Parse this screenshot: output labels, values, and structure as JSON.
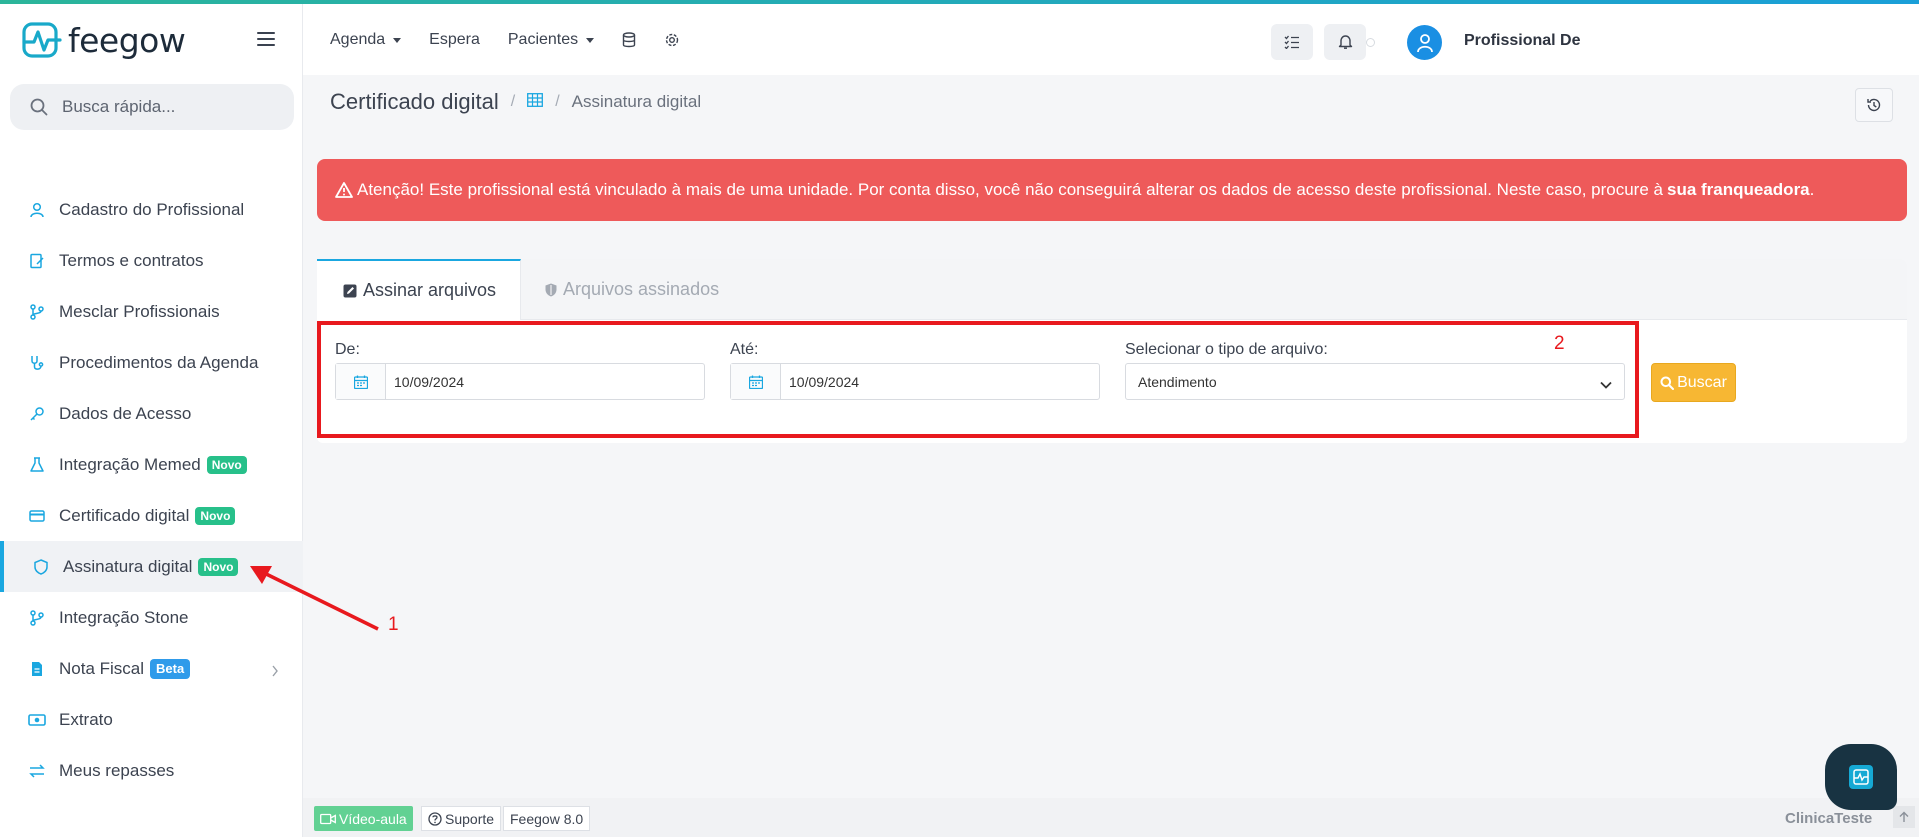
{
  "brand": {
    "name": "feegow",
    "accent": "#1aa7e0",
    "logo_color": "#19a9c9"
  },
  "search": {
    "placeholder": "Busca rápida..."
  },
  "sidebar": {
    "items": [
      {
        "label": "Cadastro do Profissional",
        "icon": "user-icon"
      },
      {
        "label": "Termos e contratos",
        "icon": "contract-icon"
      },
      {
        "label": "Mesclar Profissionais",
        "icon": "merge-icon"
      },
      {
        "label": "Procedimentos da Agenda",
        "icon": "stethoscope-icon"
      },
      {
        "label": "Dados de Acesso",
        "icon": "key-icon"
      },
      {
        "label": "Integração Memed",
        "icon": "flask-icon",
        "badge": "Novo"
      },
      {
        "label": "Certificado digital",
        "icon": "card-icon",
        "badge": "Novo"
      },
      {
        "label": "Assinatura digital",
        "icon": "shield-icon",
        "badge": "Novo",
        "active": true
      },
      {
        "label": "Integração Stone",
        "icon": "merge-icon"
      },
      {
        "label": "Nota Fiscal",
        "icon": "file-icon",
        "badge": "Beta"
      },
      {
        "label": "Extrato",
        "icon": "money-icon"
      },
      {
        "label": "Meus repasses",
        "icon": "transfer-icon"
      }
    ]
  },
  "header": {
    "nav": [
      "Agenda",
      "Espera",
      "Pacientes"
    ],
    "user_name": "Profissional De"
  },
  "breadcrumb": {
    "title": "Certificado digital",
    "sep": "/",
    "current": "Assinatura digital"
  },
  "alert": {
    "text": "Atenção! Este profissional está vinculado à mais de uma unidade. Por conta disso, você não conseguirá alterar os dados de acesso deste profissional. Neste caso, procure à",
    "bold": "sua franqueadora",
    "end": ".",
    "color": "#ee5a5a"
  },
  "tabs": {
    "active": "Assinar arquivos",
    "inactive": "Arquivos assinados"
  },
  "form": {
    "from_label": "De:",
    "from_value": "10/09/2024",
    "to_label": "Até:",
    "to_value": "10/09/2024",
    "type_label": "Selecionar o tipo de arquivo:",
    "type_value": "Atendimento",
    "search_button": "Buscar"
  },
  "annotations": {
    "one": "1",
    "two": "2",
    "color": "#e8191e"
  },
  "footer": {
    "video": "Vídeo-aula",
    "support": "Suporte",
    "version": "Feegow 8.0",
    "clinic": "ClinicaTeste"
  }
}
